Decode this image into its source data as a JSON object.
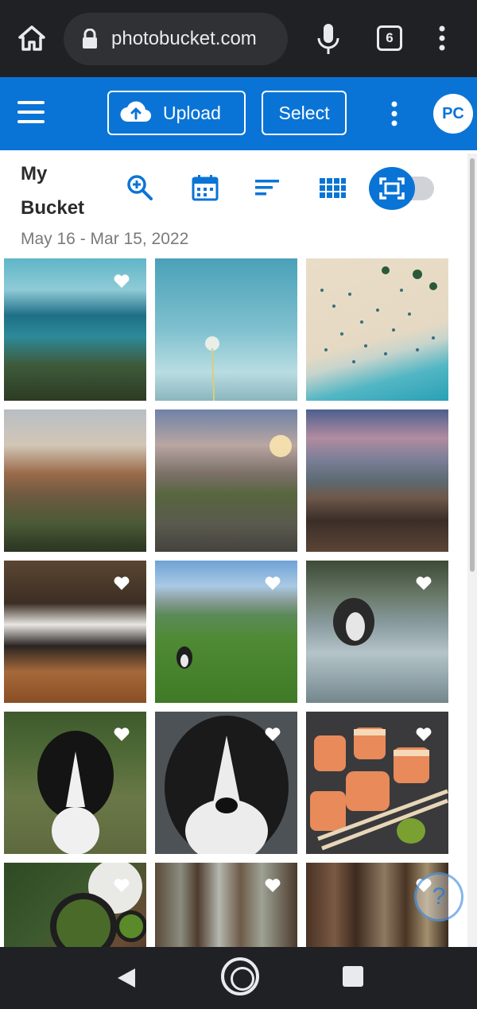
{
  "browser": {
    "url": "photobucket.com",
    "tab_count": "6"
  },
  "app_header": {
    "upload_label": "Upload",
    "select_label": "Select",
    "avatar_initials": "PC",
    "brand_color": "#0a74d6"
  },
  "toolbar": {
    "title": "My Bucket",
    "date_range": "May 16 - Mar 15, 2022",
    "icons": [
      "zoom-in-icon",
      "calendar-icon",
      "sort-icon",
      "grid-view-icon",
      "fullscreen-view-icon"
    ]
  },
  "photos": [
    {
      "subject": "coastal aerial view",
      "favorited": true
    },
    {
      "subject": "dandelion against sky",
      "favorited": false
    },
    {
      "subject": "aerial beach with people",
      "favorited": false
    },
    {
      "subject": "mountain ridge at sunrise",
      "favorited": false
    },
    {
      "subject": "mountain peak sunset",
      "favorited": false
    },
    {
      "subject": "rocky beach at dusk",
      "favorited": false
    },
    {
      "subject": "dog lying on floor",
      "favorited": true
    },
    {
      "subject": "dog in green field",
      "favorited": true
    },
    {
      "subject": "dog running through water",
      "favorited": true
    },
    {
      "subject": "dog in grass",
      "favorited": true
    },
    {
      "subject": "dog close-up portrait",
      "favorited": true
    },
    {
      "subject": "sushi rolls with chopsticks",
      "favorited": true
    },
    {
      "subject": "food bowls on table",
      "favorited": true
    },
    {
      "subject": "forest trees",
      "favorited": true
    },
    {
      "subject": "redwood trunks",
      "favorited": true
    }
  ]
}
